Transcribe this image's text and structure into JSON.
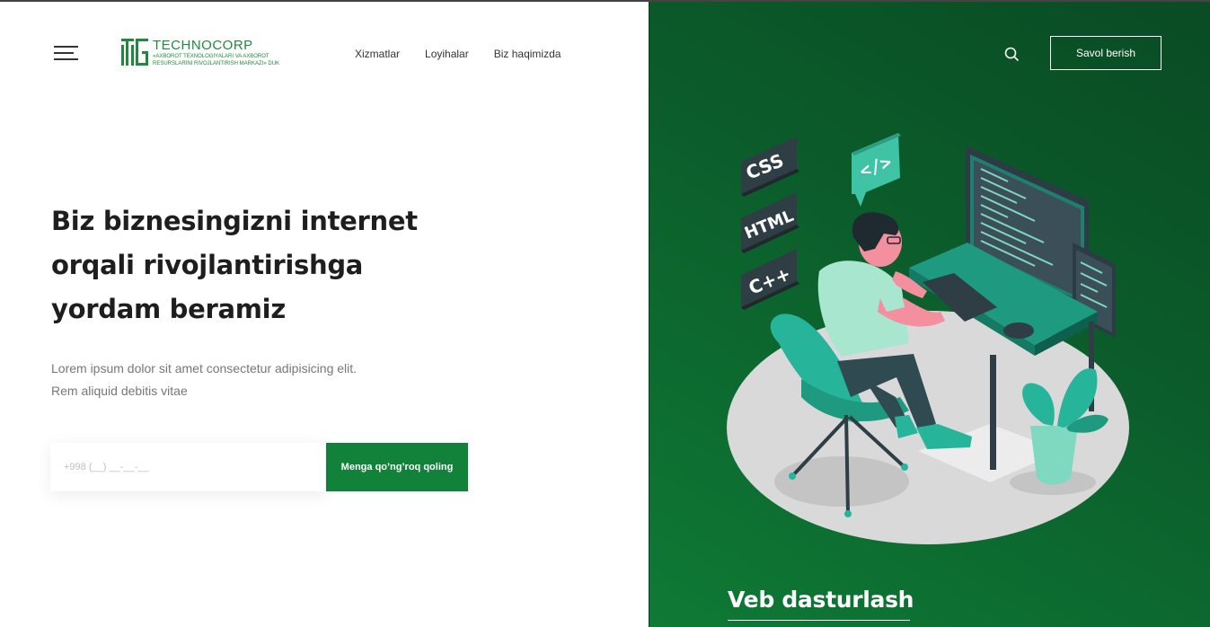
{
  "header": {
    "logo": {
      "name": "TECHNOCORP",
      "subtitle": "«AXBOROT TEXNOLOGIYALARI VA AXBOROT RESURSLARINI RIVOJLANTIRISH MARKAZI» DUK",
      "color": "#1e8a3c"
    },
    "nav": [
      {
        "label": "Xizmatlar"
      },
      {
        "label": "Loyihalar"
      },
      {
        "label": "Biz haqimizda"
      }
    ],
    "ask_button": "Savol berish"
  },
  "hero": {
    "title": "Biz biznesingizni internet orqali rivojlantirishga yordam beramiz",
    "subtitle_line1": "Lorem ipsum dolor sit amet consectetur adipisicing elit.",
    "subtitle_line2": "Rem aliquid debitis vitae",
    "phone_placeholder": "+998 (__) __-__-__",
    "call_button": "Menga qo’ng’roq qoling"
  },
  "slide": {
    "title": "Veb dasturlash",
    "tags": [
      "CSS",
      "HTML",
      "C++"
    ]
  },
  "colors": {
    "accent": "#12823a",
    "panel_dark": "#0a4b24",
    "panel_light": "#0e7a35",
    "teal": "#26b59a"
  }
}
